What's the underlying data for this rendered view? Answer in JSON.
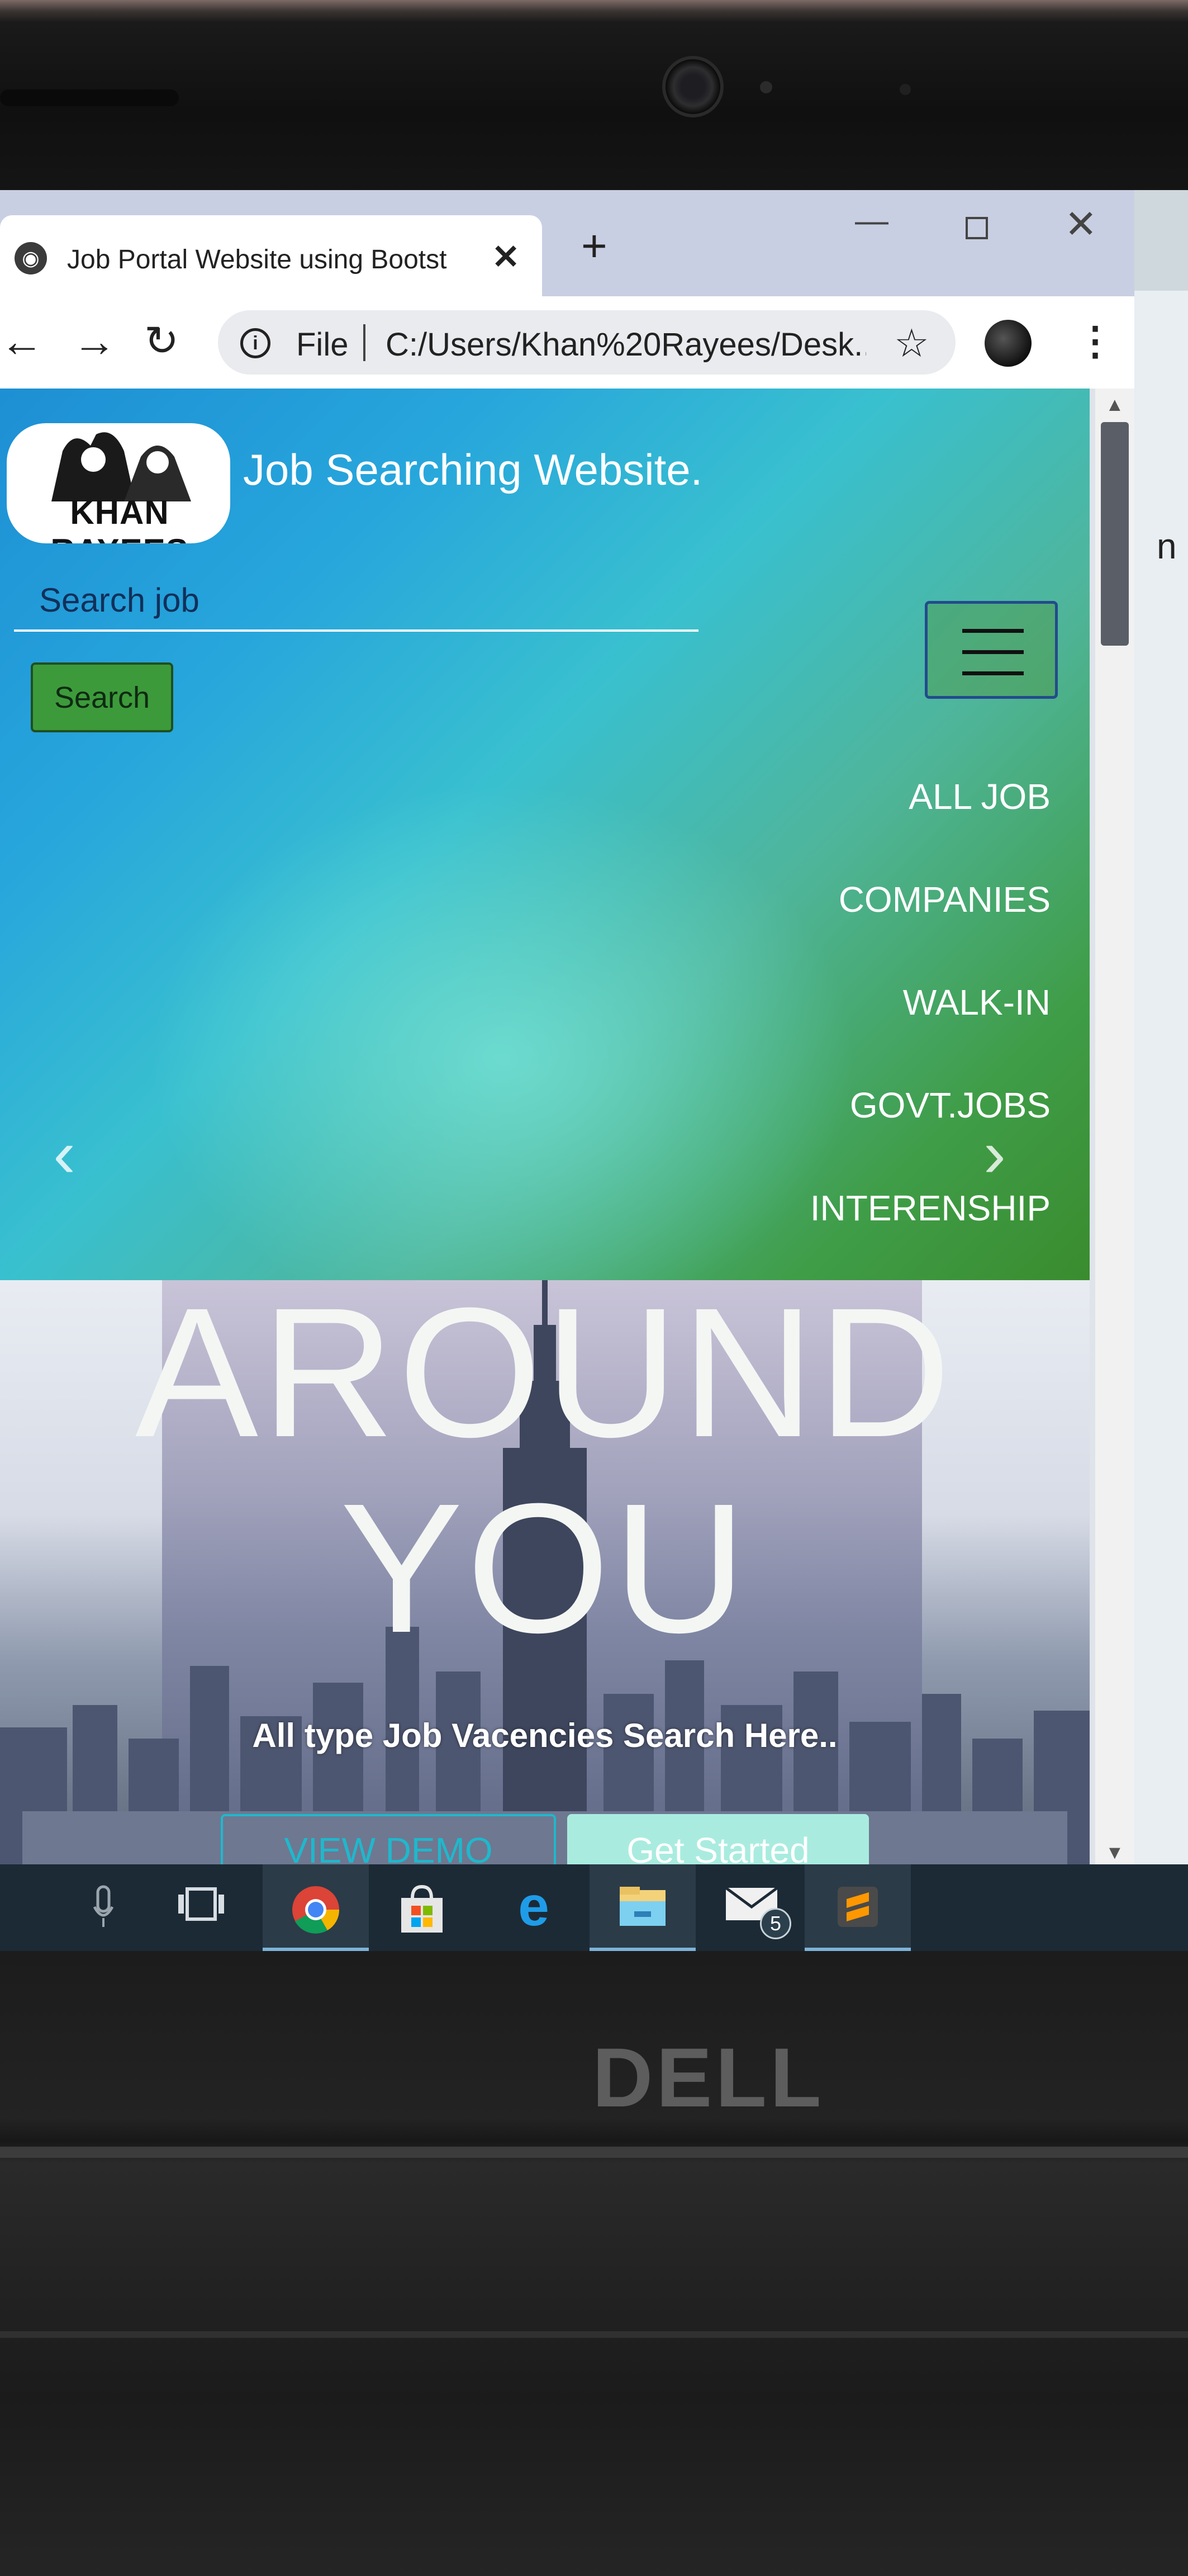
{
  "browser": {
    "tab_title": "Job Portal Website using Bootstra",
    "tab_close": "✕",
    "new_tab": "+",
    "url_scheme": "File",
    "url": "C:/Users/Khan%20Rayees/Desk..."
  },
  "page": {
    "logo_text": "KHAN RAYEES",
    "site_title": "Job Searching Website.",
    "search_placeholder": "Search job",
    "search_button": "Search",
    "nav_links": [
      "ALL JOB",
      "COMPANIES",
      "WALK-IN",
      "GOVT.JOBS",
      "INTERENSHIP"
    ],
    "hero_line1": "AROUND",
    "hero_line2": "YOU",
    "hero_sub": "All type Job Vacencies Search Here..",
    "btn_demo": "VIEW DEMO",
    "btn_start": "Get Started"
  },
  "taskbar": {
    "mail_badge": "5"
  },
  "desktop": {
    "edge_letter": "n"
  },
  "laptop": {
    "brand": "DELL"
  },
  "icons": [
    "globe-icon",
    "close-icon",
    "plus-icon",
    "back-icon",
    "forward-icon",
    "reload-icon",
    "info-icon",
    "star-icon",
    "avatar-icon",
    "more-icon",
    "hamburger-icon",
    "chevron-left-icon",
    "chevron-right-icon",
    "microphone-icon",
    "task-view-icon",
    "chrome-icon",
    "store-icon",
    "edge-icon",
    "file-explorer-icon",
    "mail-icon",
    "sublime-icon"
  ]
}
